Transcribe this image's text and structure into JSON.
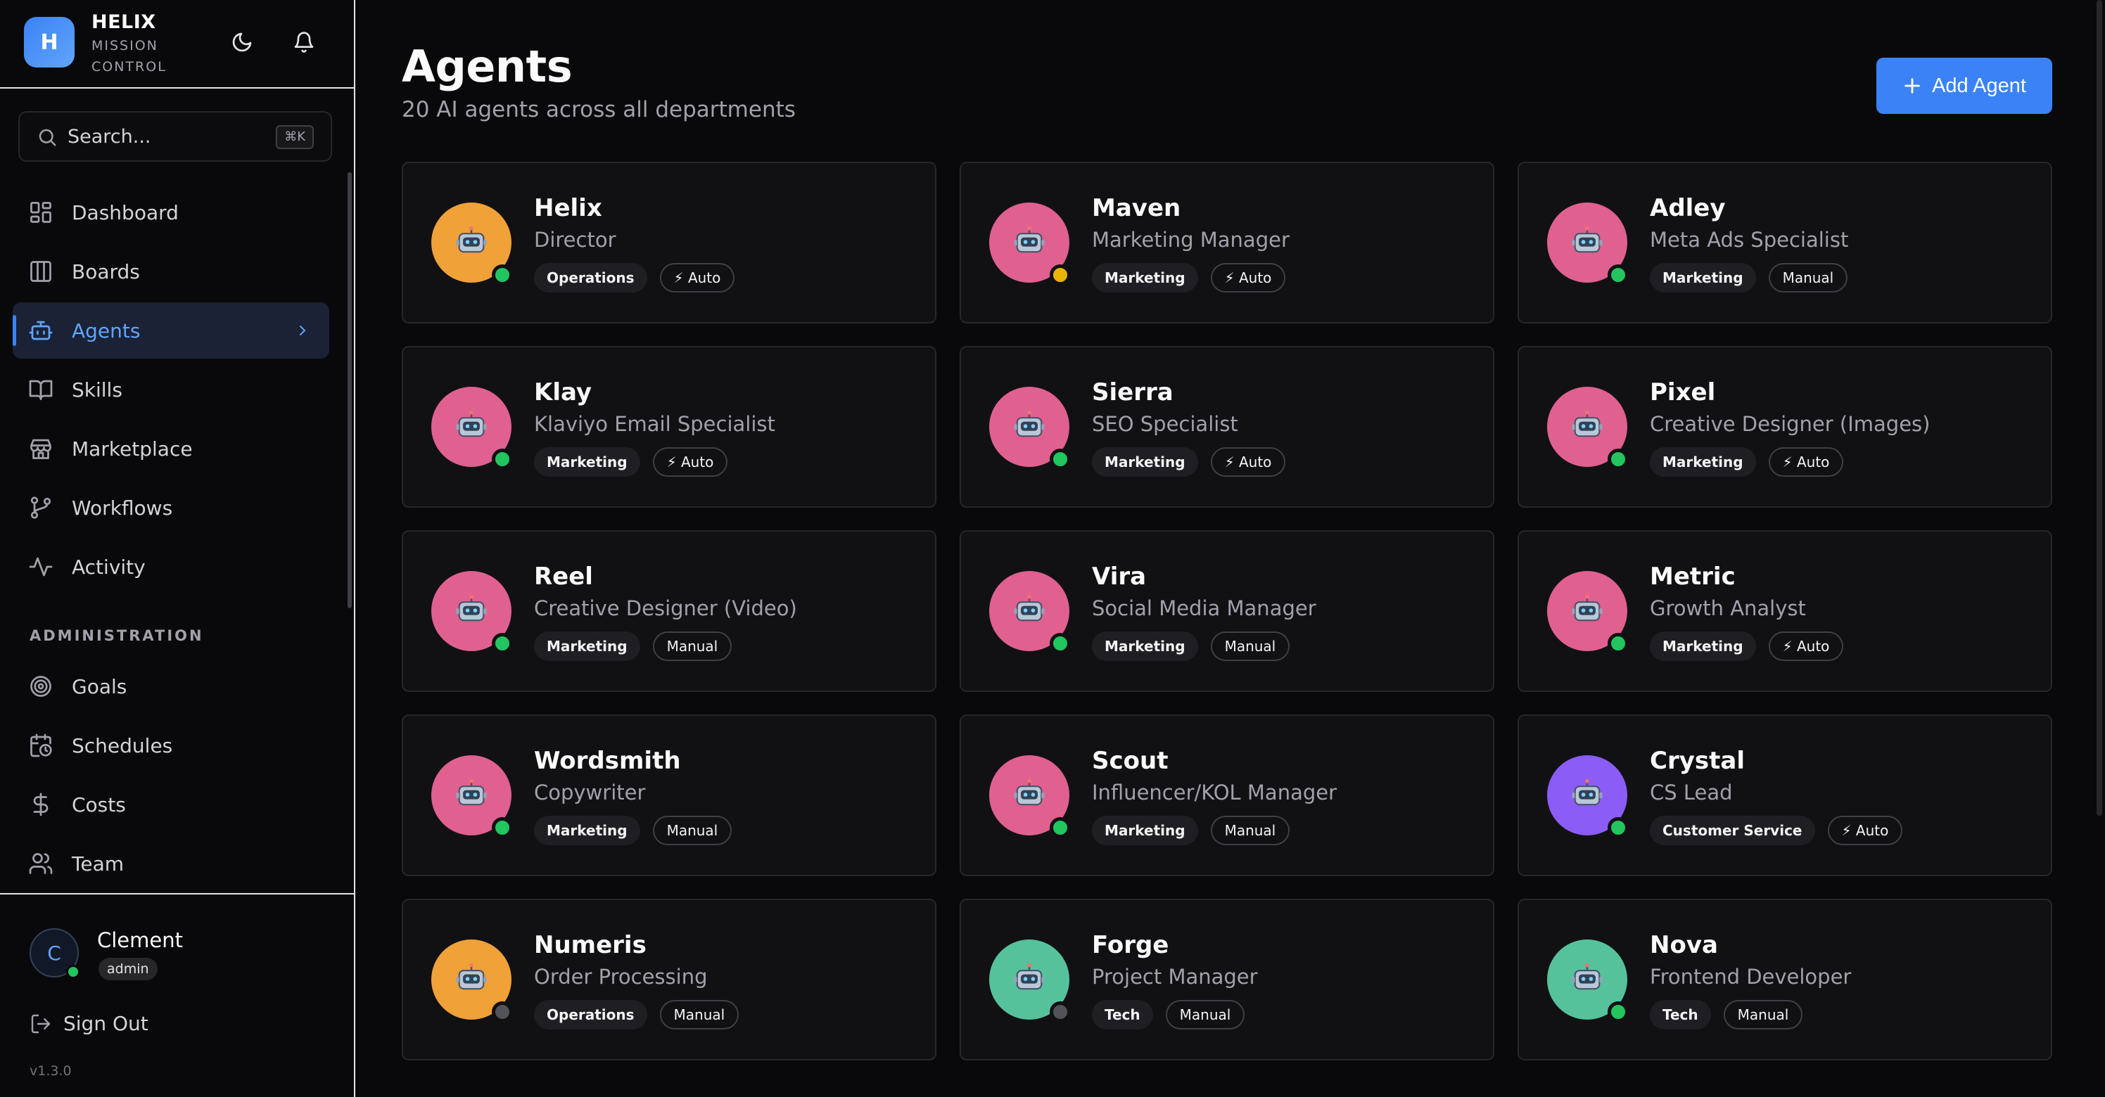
{
  "brand": {
    "logo_letter": "H",
    "name": "HELIX",
    "subtitle": "MISSION CONTROL"
  },
  "header_icons": [
    "moon-icon",
    "bell-icon"
  ],
  "search": {
    "placeholder": "Search...",
    "shortcut": "⌘K"
  },
  "nav": {
    "items": [
      {
        "label": "Dashboard",
        "icon": "dashboard-icon"
      },
      {
        "label": "Boards",
        "icon": "columns-icon"
      },
      {
        "label": "Agents",
        "icon": "robot-icon",
        "active": true
      },
      {
        "label": "Skills",
        "icon": "book-icon"
      },
      {
        "label": "Marketplace",
        "icon": "store-icon"
      },
      {
        "label": "Workflows",
        "icon": "workflow-icon"
      },
      {
        "label": "Activity",
        "icon": "activity-icon"
      }
    ],
    "admin_label": "ADMINISTRATION",
    "admin_items": [
      {
        "label": "Goals",
        "icon": "target-icon"
      },
      {
        "label": "Schedules",
        "icon": "calendar-clock-icon"
      },
      {
        "label": "Costs",
        "icon": "dollar-icon"
      },
      {
        "label": "Team",
        "icon": "users-icon"
      }
    ]
  },
  "user": {
    "initial": "C",
    "name": "Clement",
    "role": "admin",
    "online": true
  },
  "sign_out_label": "Sign Out",
  "version": "v1.3.0",
  "page": {
    "title": "Agents",
    "subtitle": "20 AI agents across all departments",
    "add_button_label": "Add Agent"
  },
  "colors": {
    "accent": "#3b82f6",
    "avatar_orange": "#f0a138",
    "avatar_pink": "#e0608f",
    "avatar_purple": "#8b5cf6",
    "avatar_green": "#55c29b",
    "status_online": "#22c55e",
    "status_busy": "#eab308",
    "status_offline": "#52525b"
  },
  "agents": [
    {
      "name": "Helix",
      "role": "Director",
      "department": "Operations",
      "mode": "⚡ Auto",
      "avatar_color": "#f0a138",
      "status_color": "#22c55e"
    },
    {
      "name": "Maven",
      "role": "Marketing Manager",
      "department": "Marketing",
      "mode": "⚡ Auto",
      "avatar_color": "#e0608f",
      "status_color": "#eab308"
    },
    {
      "name": "Adley",
      "role": "Meta Ads Specialist",
      "department": "Marketing",
      "mode": "Manual",
      "avatar_color": "#e0608f",
      "status_color": "#22c55e"
    },
    {
      "name": "Klay",
      "role": "Klaviyo Email Specialist",
      "department": "Marketing",
      "mode": "⚡ Auto",
      "avatar_color": "#e0608f",
      "status_color": "#22c55e"
    },
    {
      "name": "Sierra",
      "role": "SEO Specialist",
      "department": "Marketing",
      "mode": "⚡ Auto",
      "avatar_color": "#e0608f",
      "status_color": "#22c55e"
    },
    {
      "name": "Pixel",
      "role": "Creative Designer (Images)",
      "department": "Marketing",
      "mode": "⚡ Auto",
      "avatar_color": "#e0608f",
      "status_color": "#22c55e"
    },
    {
      "name": "Reel",
      "role": "Creative Designer (Video)",
      "department": "Marketing",
      "mode": "Manual",
      "avatar_color": "#e0608f",
      "status_color": "#22c55e"
    },
    {
      "name": "Vira",
      "role": "Social Media Manager",
      "department": "Marketing",
      "mode": "Manual",
      "avatar_color": "#e0608f",
      "status_color": "#22c55e"
    },
    {
      "name": "Metric",
      "role": "Growth Analyst",
      "department": "Marketing",
      "mode": "⚡ Auto",
      "avatar_color": "#e0608f",
      "status_color": "#22c55e"
    },
    {
      "name": "Wordsmith",
      "role": "Copywriter",
      "department": "Marketing",
      "mode": "Manual",
      "avatar_color": "#e0608f",
      "status_color": "#22c55e"
    },
    {
      "name": "Scout",
      "role": "Influencer/KOL Manager",
      "department": "Marketing",
      "mode": "Manual",
      "avatar_color": "#e0608f",
      "status_color": "#22c55e"
    },
    {
      "name": "Crystal",
      "role": "CS Lead",
      "department": "Customer Service",
      "mode": "⚡ Auto",
      "avatar_color": "#8b5cf6",
      "status_color": "#22c55e"
    },
    {
      "name": "Numeris",
      "role": "Order Processing",
      "department": "Operations",
      "mode": "Manual",
      "avatar_color": "#f0a138",
      "status_color": "#52525b"
    },
    {
      "name": "Forge",
      "role": "Project Manager",
      "department": "Tech",
      "mode": "Manual",
      "avatar_color": "#55c29b",
      "status_color": "#52525b"
    },
    {
      "name": "Nova",
      "role": "Frontend Developer",
      "department": "Tech",
      "mode": "Manual",
      "avatar_color": "#55c29b",
      "status_color": "#22c55e"
    }
  ]
}
